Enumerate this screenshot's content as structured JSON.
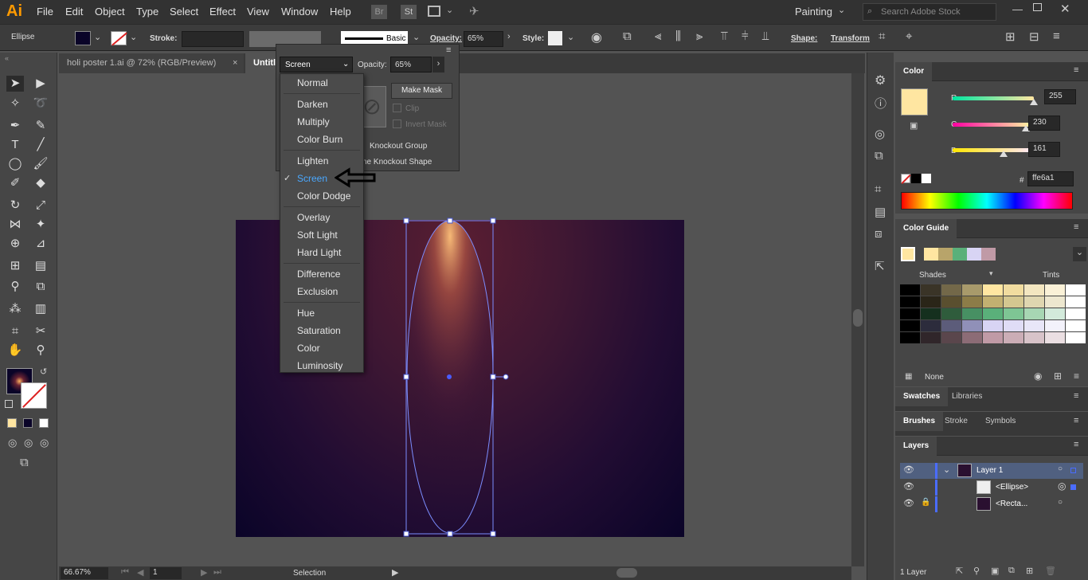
{
  "app": {
    "logo": "Ai",
    "workspace": "Painting",
    "search_placeholder": "Search Adobe Stock"
  },
  "menu": [
    "File",
    "Edit",
    "Object",
    "Type",
    "Select",
    "Effect",
    "View",
    "Window",
    "Help"
  ],
  "menu_icons": {
    "br": "Br",
    "st": "St"
  },
  "control": {
    "object_type": "Ellipse",
    "stroke_label": "Stroke:",
    "brush_label": "Basic",
    "opacity_label": "Opacity:",
    "opacity_value": "65%",
    "style_label": "Style:",
    "shape_label": "Shape:",
    "transform_label": "Transform"
  },
  "tabs": [
    {
      "label": "holi poster 1.ai @ 72% (RGB/Preview)",
      "close": "×"
    },
    {
      "label": "Untitl"
    }
  ],
  "transparency": {
    "blend_mode": "Screen",
    "opacity_label": "Opacity:",
    "opacity_value": "65%",
    "make_mask": "Make Mask",
    "clip": "Clip",
    "invert_mask": "Invert Mask",
    "knockout_group": "Knockout Group",
    "knockout_shape": "ne Knockout Shape"
  },
  "blend_modes": [
    [
      "Normal"
    ],
    [
      "Darken",
      "Multiply",
      "Color Burn"
    ],
    [
      "Lighten",
      "Screen",
      "Color Dodge"
    ],
    [
      "Overlay",
      "Soft Light",
      "Hard Light"
    ],
    [
      "Difference",
      "Exclusion"
    ],
    [
      "Hue",
      "Saturation",
      "Color",
      "Luminosity"
    ]
  ],
  "blend_selected": "Screen",
  "status": {
    "zoom": "66.67%",
    "page": "1",
    "tool": "Selection"
  },
  "color_panel": {
    "title": "Color",
    "r_label": "R",
    "r": "255",
    "r_frac": 1.0,
    "g_label": "G",
    "g": "230",
    "g_frac": 0.902,
    "b_label": "B",
    "b": "161",
    "b_frac": 0.631,
    "hex_label": "#",
    "hex": "ffe6a1",
    "fill_color": "#ffe6a1"
  },
  "color_guide": {
    "title": "Color Guide",
    "shades": "Shades",
    "tints": "Tints",
    "none_label": "None",
    "harmony": [
      "#ffe6a1",
      "#b8a46a",
      "#5ab07a",
      "#d8d4f4",
      "#c09aa6"
    ],
    "grid": [
      [
        "#000000",
        "#3a3427",
        "#736849",
        "#a89a6b",
        "#ffe6a1",
        "#f1dc9f",
        "#f3e6c0",
        "#faf1d7",
        "#ffffff"
      ],
      [
        "#000000",
        "#2a2518",
        "#5a4f2f",
        "#8c7c48",
        "#c2b071",
        "#d4c790",
        "#dfd6b0",
        "#ede7cf",
        "#ffffff"
      ],
      [
        "#000000",
        "#15301e",
        "#2f5c3c",
        "#479063",
        "#5ab07a",
        "#7ec594",
        "#a7d6b3",
        "#d3eadb",
        "#ffffff"
      ],
      [
        "#000000",
        "#2c2c3c",
        "#5c5c7a",
        "#9090b8",
        "#d8d4f4",
        "#e0ddf6",
        "#e8e6f8",
        "#f3f2fb",
        "#ffffff"
      ],
      [
        "#000000",
        "#30262a",
        "#5a464c",
        "#8c6c76",
        "#c09aa6",
        "#cbadb6",
        "#d8c3c9",
        "#ebdfe2",
        "#ffffff"
      ]
    ]
  },
  "panel_tabs": {
    "swatches": "Swatches",
    "libraries": "Libraries",
    "brushes": "Brushes",
    "stroke": "Stroke",
    "symbols": "Symbols",
    "layers": "Layers"
  },
  "layers": [
    {
      "name": "Layer 1"
    },
    {
      "name": "<Ellipse>"
    },
    {
      "name": "<Recta..."
    }
  ],
  "layers_footer": "1 Layer"
}
